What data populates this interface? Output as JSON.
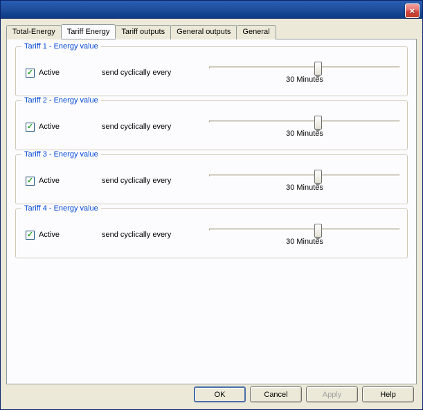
{
  "tabs": {
    "items": [
      {
        "label": "Total-Energy",
        "active": false
      },
      {
        "label": "Tariff Energy",
        "active": true
      },
      {
        "label": "Tariff outputs",
        "active": false
      },
      {
        "label": "General outputs",
        "active": false
      },
      {
        "label": "General",
        "active": false
      }
    ]
  },
  "groups": [
    {
      "title": "Tariff 1 - Energy value",
      "checked": true,
      "active_label": "Active",
      "send_label": "send cyclically every",
      "value_label": "30 Minutes"
    },
    {
      "title": "Tariff 2 - Energy value",
      "checked": true,
      "active_label": "Active",
      "send_label": "send cyclically every",
      "value_label": "30 Minutes"
    },
    {
      "title": "Tariff 3 - Energy value",
      "checked": true,
      "active_label": "Active",
      "send_label": "send cyclically every",
      "value_label": "30 Minutes"
    },
    {
      "title": "Tariff 4 - Energy value",
      "checked": true,
      "active_label": "Active",
      "send_label": "send cyclically every",
      "value_label": "30 Minutes"
    }
  ],
  "buttons": {
    "ok": "OK",
    "cancel": "Cancel",
    "apply": "Apply",
    "help": "Help"
  }
}
